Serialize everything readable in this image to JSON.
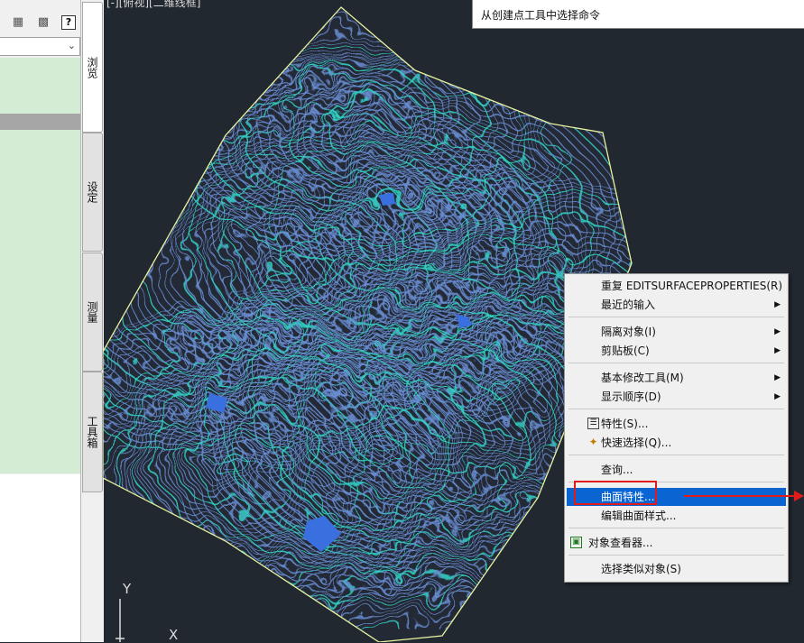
{
  "viewport": {
    "label": "[-][俯视][二维线框]"
  },
  "tooltip": {
    "text": "从创建点工具中选择命令"
  },
  "left_panel": {
    "toolbar": {
      "icons": [
        "network-icon",
        "save-icon",
        "help-icon"
      ],
      "help_label": "?"
    },
    "dropdown": {
      "value": ""
    }
  },
  "tabs": [
    {
      "label": "浏览",
      "active": true
    },
    {
      "label": "设定",
      "active": false
    },
    {
      "label": "测量",
      "active": false
    },
    {
      "label": "工具箱",
      "active": false
    }
  ],
  "context_menu": {
    "items": [
      {
        "label": "重复 EDITSURFACEPROPERTIES(R)",
        "submenu": false
      },
      {
        "label": "最近的输入",
        "submenu": true
      },
      {
        "label": "隔离对象(I)",
        "submenu": true
      },
      {
        "label": "剪贴板(C)",
        "submenu": true
      },
      {
        "label": "基本修改工具(M)",
        "submenu": true
      },
      {
        "label": "显示顺序(D)",
        "submenu": true
      },
      {
        "label": "特性(S)...",
        "submenu": false,
        "icon": "properties-icon"
      },
      {
        "label": "快速选择(Q)...",
        "submenu": false,
        "icon": "quick-select-icon"
      },
      {
        "label": "查询...",
        "submenu": false
      },
      {
        "label": "曲面特性...",
        "submenu": false,
        "highlighted": true
      },
      {
        "label": "编辑曲面样式...",
        "submenu": false
      },
      {
        "label": "对象查看器...",
        "submenu": false,
        "icon": "object-viewer-icon"
      },
      {
        "label": "选择类似对象(S)",
        "submenu": false
      }
    ]
  },
  "ucs": {
    "y_label": "Y",
    "x_label": "X"
  },
  "colors": {
    "canvas": "#212830",
    "contour_major": "#33d4c8",
    "contour_minor": "#6b8fd6",
    "surface_fill": "#3a6fe0",
    "boundary": "#e8f2a0",
    "menu_highlight": "#0a64d2",
    "annotation": "#e11a1a",
    "panel_green": "#d4ecd4"
  }
}
